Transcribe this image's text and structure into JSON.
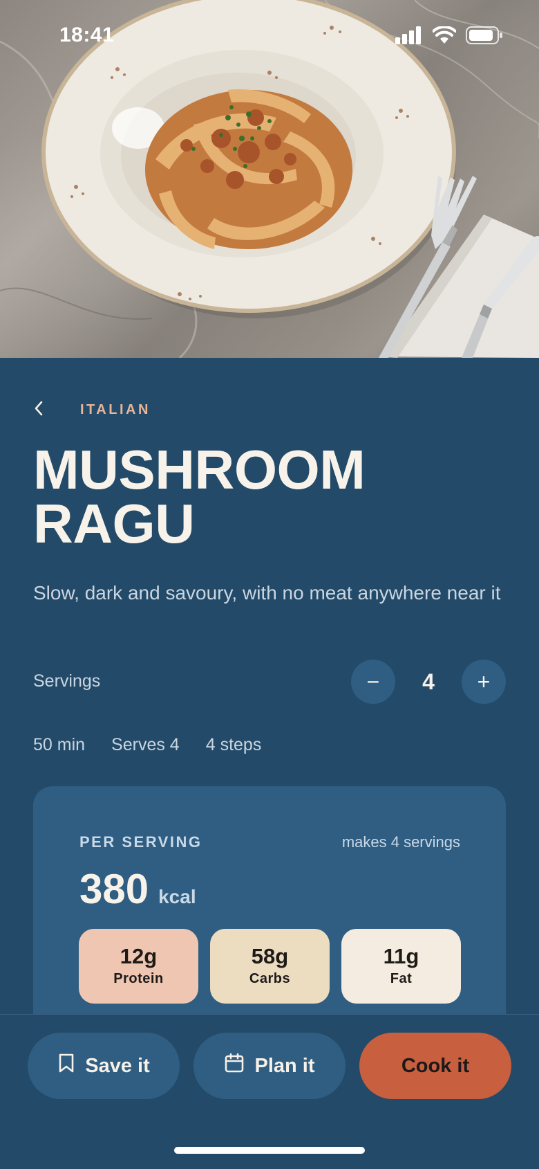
{
  "status_bar": {
    "time": "18:41"
  },
  "header": {
    "back_icon": "chevron-left-icon",
    "category": "ITALIAN"
  },
  "recipe": {
    "title": "MUSHROOM RAGU",
    "subtitle": "Slow, dark and savoury, with no meat anywhere near it"
  },
  "servings": {
    "label": "Servings",
    "value": "4",
    "minus": "−",
    "plus": "+"
  },
  "meta": {
    "time": "50 min",
    "serves": "Serves 4",
    "steps": "4 steps"
  },
  "nutrition": {
    "heading": "PER SERVING",
    "makes": "makes 4 servings",
    "kcal_value": "380",
    "kcal_unit": "kcal",
    "macros": [
      {
        "value": "12g",
        "label": "Protein",
        "color": "#efc6b1"
      },
      {
        "value": "58g",
        "label": "Carbs",
        "color": "#ecdcc0"
      },
      {
        "value": "11g",
        "label": "Fat",
        "color": "#f4ece0"
      }
    ]
  },
  "actions": {
    "save_label": "Save it",
    "plan_label": "Plan it",
    "cook_label": "Cook it"
  },
  "colors": {
    "background": "#234a68",
    "card": "#2f5e82",
    "accent": "#c85f3f",
    "category": "#e8b598"
  }
}
